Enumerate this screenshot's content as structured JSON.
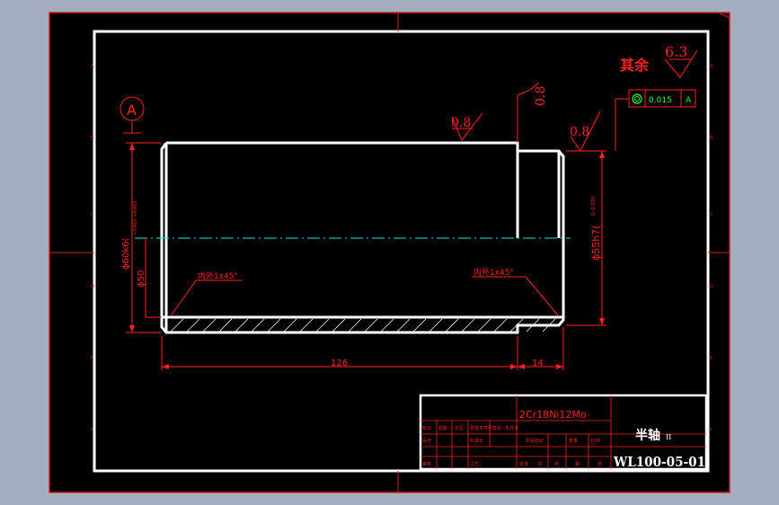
{
  "datum_label": "A",
  "roughness_other_label": "其余",
  "roughness_other_value": "6.3",
  "roughness_top_left": "0.8",
  "roughness_top_mid": "0.8",
  "roughness_step": "0.8",
  "tolerance_frame": {
    "value": "0.015",
    "datum": "A"
  },
  "dim_dia_large": "ϕ60k6(",
  "dim_dia_large_tol": "+0.021 +0.002",
  "dim_dia_bore": "ϕ50",
  "dim_dia_small": "ϕ55h7(",
  "dim_dia_small_tol": "0 -0.030",
  "chamfer_left": "内外1x45°",
  "chamfer_right": "内外1x45°",
  "dim_length_main": "126",
  "dim_length_step": "14",
  "title_block": {
    "material": "2Cr18Ni12Mo",
    "part_name": "半轴",
    "part_name_suffix": "II",
    "drawing_no": "WL100-05-01",
    "header_cells": [
      "标记",
      "处数",
      "分区",
      "更改文件号",
      "签名",
      "年月日"
    ],
    "row2_cells": [
      "设计",
      "标准化",
      "阶段标记",
      "重量",
      "比例"
    ],
    "row3_cells": [
      "审核",
      "工艺",
      "批准",
      "共",
      "张",
      "第",
      "张"
    ]
  }
}
